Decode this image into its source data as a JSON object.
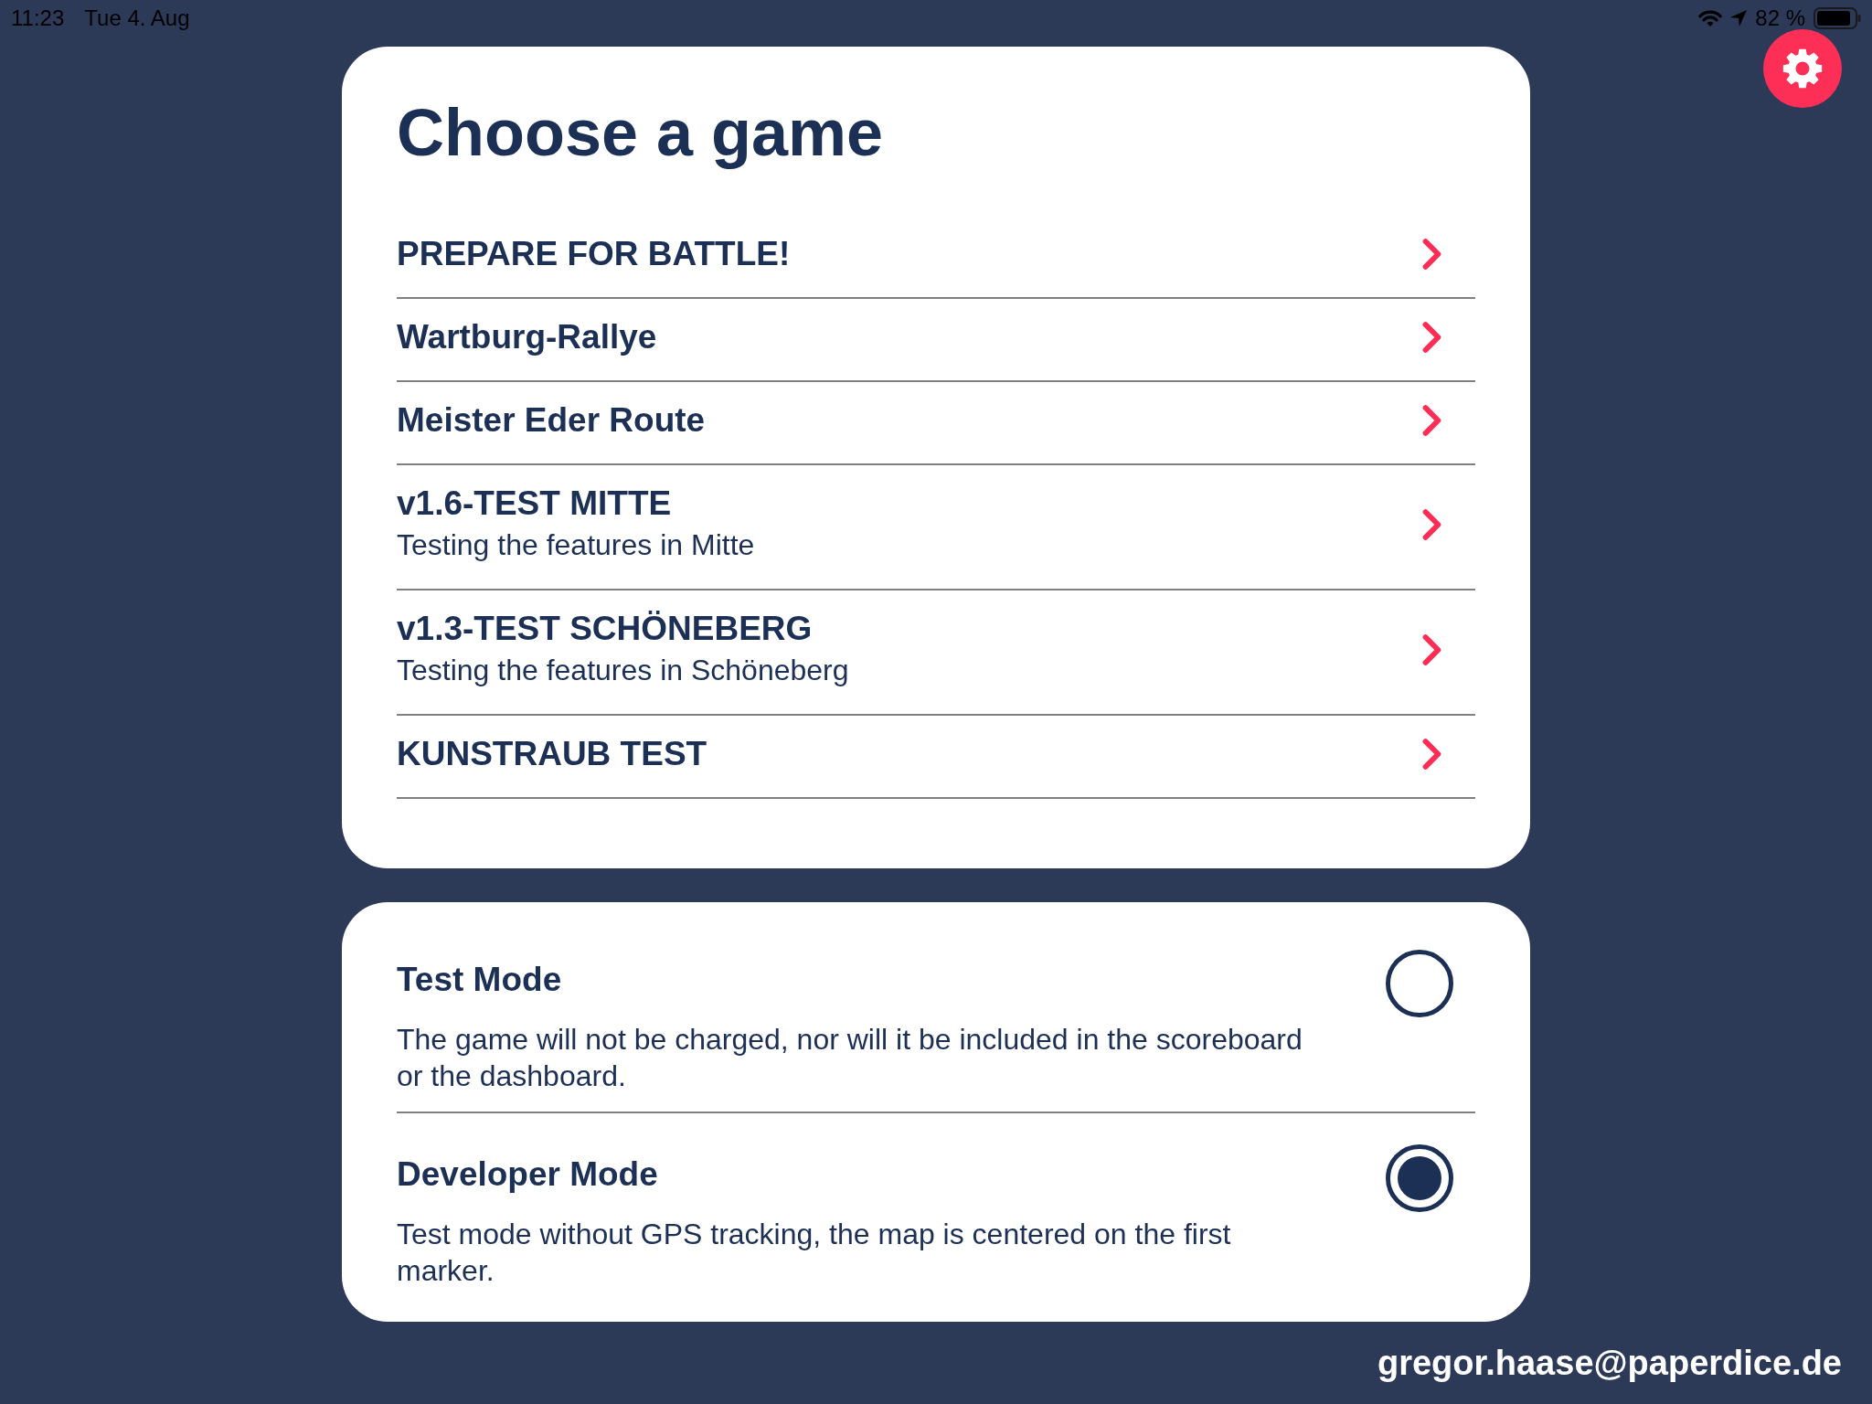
{
  "status_bar": {
    "time": "11:23",
    "date": "Tue 4. Aug",
    "battery": "82 %"
  },
  "games": {
    "title": "Choose a game",
    "items": [
      {
        "title": "PREPARE FOR BATTLE!"
      },
      {
        "title": "Wartburg-Rallye"
      },
      {
        "title": "Meister Eder Route"
      },
      {
        "title": "v1.6-TEST MITTE",
        "subtitle": "Testing the features in Mitte"
      },
      {
        "title": "v1.3-TEST SCHÖNEBERG",
        "subtitle": "Testing the features in Schöneberg"
      },
      {
        "title": "KUNSTRAUB TEST"
      }
    ]
  },
  "modes": [
    {
      "title": "Test Mode",
      "description": "The game will not be charged, nor will it be included in the scoreboard or the dashboard.",
      "checked": false
    },
    {
      "title": "Developer Mode",
      "description": "Test mode without GPS tracking, the map is centered on the first marker.",
      "checked": true
    }
  ],
  "footer": {
    "email": "gregor.haase@paperdice.de"
  }
}
